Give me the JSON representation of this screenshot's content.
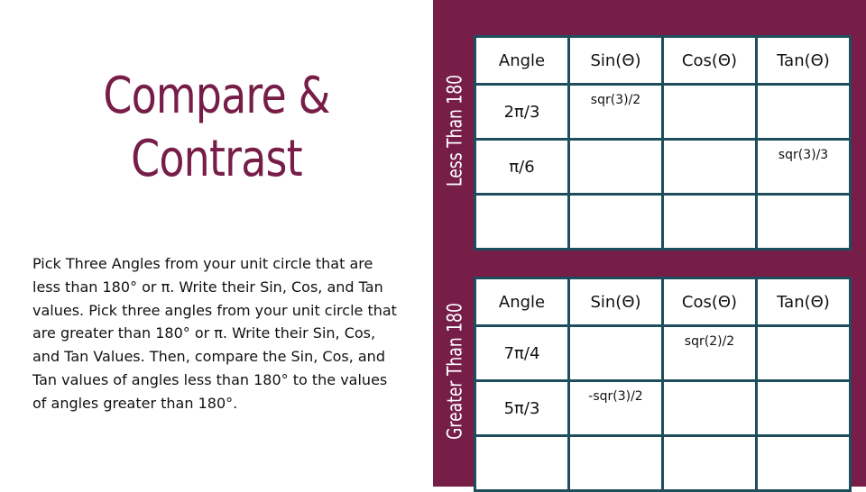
{
  "slide": {
    "title_line1": "Compare &",
    "title_line2": "Contrast",
    "instructions": "Pick Three Angles from your unit circle that are less than 180° or π. Write their Sin, Cos, and Tan values. Pick three angles from your unit circle that are greater than 180° or π. Write their Sin, Cos, and Tan Values. Then, compare the Sin, Cos, and Tan values of angles less than 180° to the values of angles greater than 180°.",
    "colors": {
      "accent": "#761d48",
      "table_border": "#1e4e5e",
      "background": "#ffffff"
    }
  },
  "tables": {
    "less": {
      "label": "Less Than 180",
      "headers": [
        "Angle",
        "Sin(Θ)",
        "Cos(Θ)",
        "Tan(Θ)"
      ],
      "rows": [
        [
          "2π/3",
          "sqr(3)/2",
          "",
          ""
        ],
        [
          "π/6",
          "",
          "",
          "sqr(3)/3"
        ],
        [
          "",
          "",
          "",
          ""
        ]
      ]
    },
    "greater": {
      "label": "Greater Than 180",
      "headers": [
        "Angle",
        "Sin(Θ)",
        "Cos(Θ)",
        "Tan(Θ)"
      ],
      "rows": [
        [
          "7π/4",
          "",
          "sqr(2)/2",
          ""
        ],
        [
          "5π/3",
          "-sqr(3)/2",
          "",
          ""
        ],
        [
          "",
          "",
          "",
          ""
        ]
      ]
    }
  }
}
